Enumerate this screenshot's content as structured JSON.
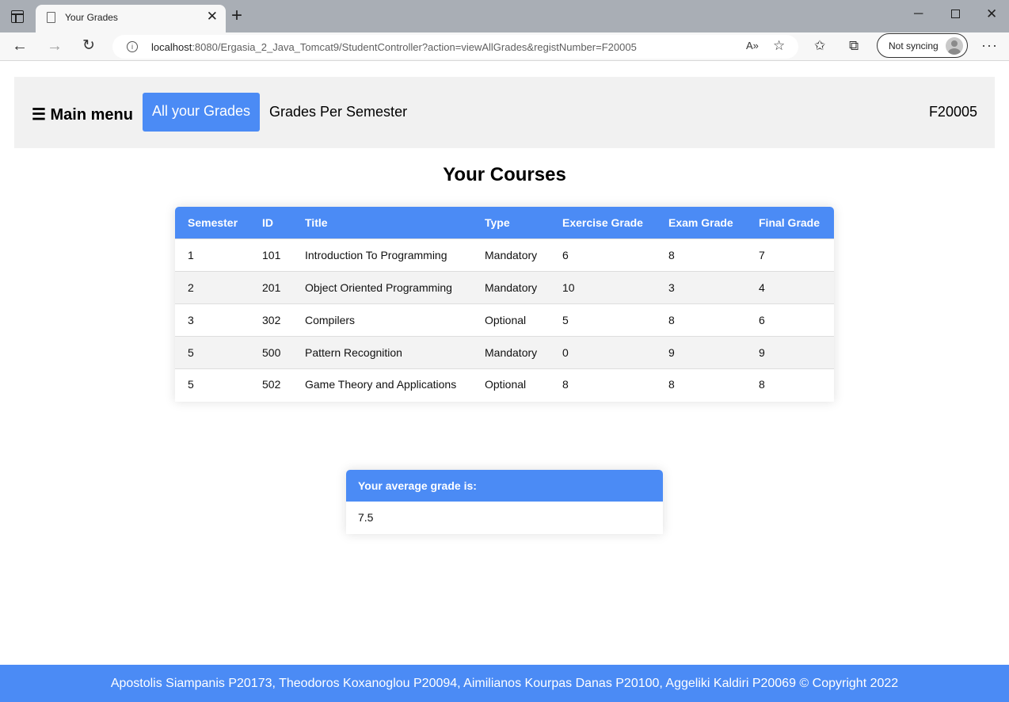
{
  "browser": {
    "tab_title": "Your Grades",
    "tab_close": "✕",
    "new_tab": "+",
    "url_host": "localhost",
    "url_rest": ":8080/Ergasia_2_Java_Tomcat9/StudentController?action=viewAllGrades&registNumber=F20005",
    "profile_label": "Not syncing",
    "minimize": "─",
    "close": "✕"
  },
  "nav": {
    "main_menu": "☰ Main menu",
    "all_grades": "All your Grades",
    "grades_per_semester": "Grades Per Semester",
    "user_id": "F20005"
  },
  "page": {
    "title": "Your Courses"
  },
  "courses": {
    "headers": [
      "Semester",
      "ID",
      "Title",
      "Type",
      "Exercise Grade",
      "Exam Grade",
      "Final Grade"
    ],
    "rows": [
      [
        "1",
        "101",
        "Introduction To Programming",
        "Mandatory",
        "6",
        "8",
        "7"
      ],
      [
        "2",
        "201",
        "Object Oriented Programming",
        "Mandatory",
        "10",
        "3",
        "4"
      ],
      [
        "3",
        "302",
        "Compilers",
        "Optional",
        "5",
        "8",
        "6"
      ],
      [
        "5",
        "500",
        "Pattern Recognition",
        "Mandatory",
        "0",
        "9",
        "9"
      ],
      [
        "5",
        "502",
        "Game Theory and Applications",
        "Optional",
        "8",
        "8",
        "8"
      ]
    ]
  },
  "average": {
    "label": "Your average grade is:",
    "value": "7.5"
  },
  "footer": {
    "text": "Apostolis Siampanis P20173, Theodoros Koxanoglou P20094, Aimilianos Kourpas Danas P20100, Aggeliki Kaldiri P20069 © Copyright 2022"
  },
  "colors": {
    "accent": "#4b8bf5",
    "navbar_bg": "#f1f1f1"
  }
}
